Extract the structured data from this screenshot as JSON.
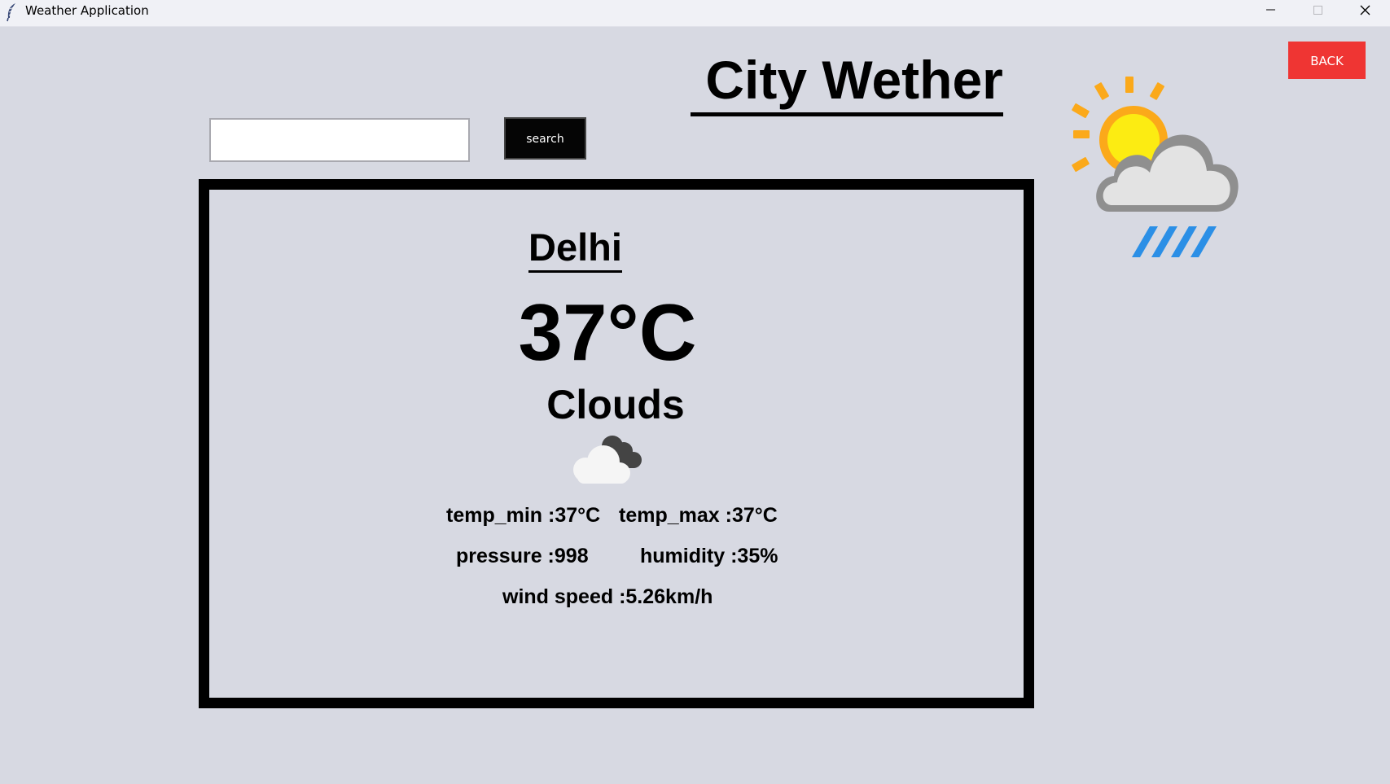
{
  "window": {
    "title": "Weather Application",
    "controls": [
      "minimize",
      "maximize",
      "close"
    ]
  },
  "header": {
    "title": " City Wether",
    "back_label": "BACK"
  },
  "search": {
    "value": "",
    "placeholder": "",
    "button_label": "search"
  },
  "weather": {
    "city": "Delhi",
    "temperature": "37°C",
    "condition": "Clouds",
    "condition_icon": "clouds-icon",
    "temp_min": "temp_min :37°C",
    "temp_max": "temp_max :37°C",
    "pressure": "pressure :998",
    "humidity": "humidity :35%",
    "wind_speed": "wind speed :5.26km/h"
  },
  "decor": {
    "illustration_icon": "sun-cloud-rain-icon",
    "colors": {
      "background": "#d7d9e2",
      "back_button": "#ef3533",
      "search_button": "#050505",
      "sun": "#fcd41c",
      "sun_rays": "#fba91a",
      "rain": "#2b8fe6"
    }
  }
}
